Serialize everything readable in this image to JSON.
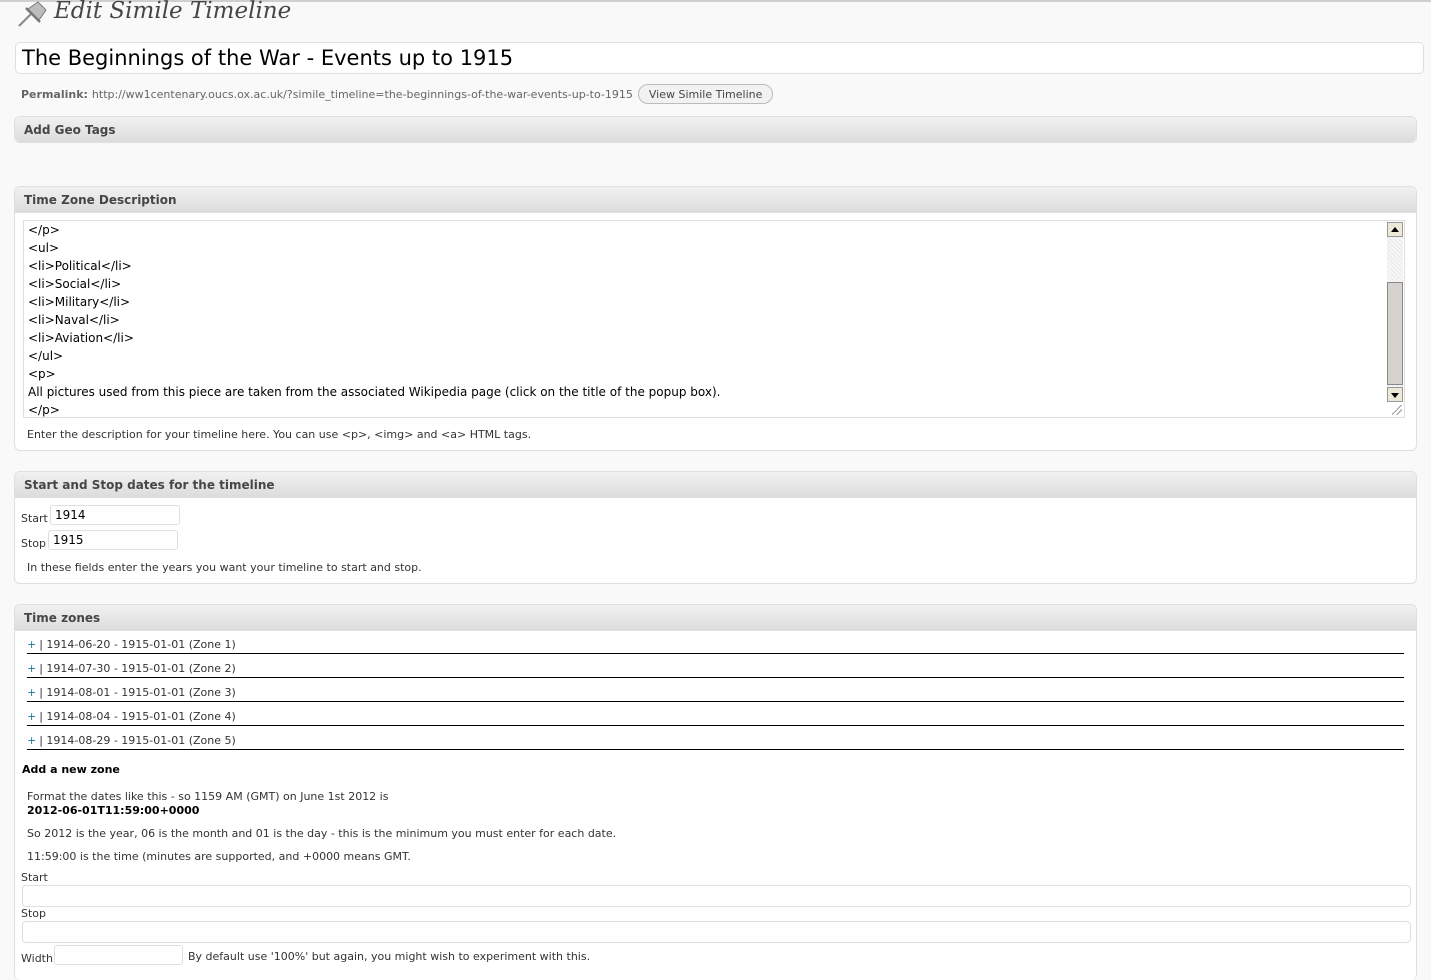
{
  "header": {
    "title": "Edit Simile Timeline",
    "icon": "pushpin-icon"
  },
  "post": {
    "title_value": "The Beginnings of the War - Events up to 1915",
    "permalink_label": "Permalink:",
    "permalink_url": "http://ww1centenary.oucs.ox.ac.uk/?simile_timeline=the-beginnings-of-the-war-events-up-to-1915",
    "view_button": "View Simile Timeline"
  },
  "geo_box": {
    "title": "Add Geo Tags"
  },
  "description_box": {
    "title": "Time Zone Description",
    "lines": [
      "</p>",
      "<ul>",
      "<li>Political</li>",
      "<li>Social</li>",
      "<li>Military</li>",
      "<li>Naval</li>",
      "<li>Aviation</li>",
      "</ul>",
      "<p>",
      "All pictures used from this piece are taken from the associated Wikipedia page (click on the title of the popup box).",
      "</p>"
    ],
    "hint": "Enter the description for your timeline here. You can use <p>, <img> and <a> HTML tags."
  },
  "dates_box": {
    "title": "Start and Stop dates for the timeline",
    "start_label": "Start",
    "start_value": "1914",
    "stop_label": "Stop",
    "stop_value": "1915",
    "hint": "In these fields enter the years you want your timeline to start and stop."
  },
  "zones_box": {
    "title": "Time zones",
    "zones": [
      {
        "toggle": "+",
        "text": "| 1914-06-20 - 1915-01-01 (Zone 1)"
      },
      {
        "toggle": "+",
        "text": "| 1914-07-30 - 1915-01-01 (Zone 2)"
      },
      {
        "toggle": "+",
        "text": "| 1914-08-01 - 1915-01-01 (Zone 3)"
      },
      {
        "toggle": "+",
        "text": "| 1914-08-04 - 1915-01-01 (Zone 4)"
      },
      {
        "toggle": "+",
        "text": "| 1914-08-29 - 1915-01-01 (Zone 5)"
      }
    ],
    "add_heading": "Add a new zone",
    "format_line1": "Format the dates like this - so 1159 AM (GMT) on June 1st 2012 is",
    "format_example": "2012-06-01T11:59:00+0000",
    "format_line2": "So 2012 is the year, 06 is the month and 01 is the day - this is the minimum you must enter for each date.",
    "format_line3": "11:59:00 is the time (minutes are supported, and +0000 means GMT.",
    "start_label": "Start",
    "start_value": "",
    "stop_label": "Stop",
    "stop_value": "",
    "width_label": "Width",
    "width_value": "",
    "width_hint": "By default use '100%' but again, you might wish to experiment with this."
  }
}
